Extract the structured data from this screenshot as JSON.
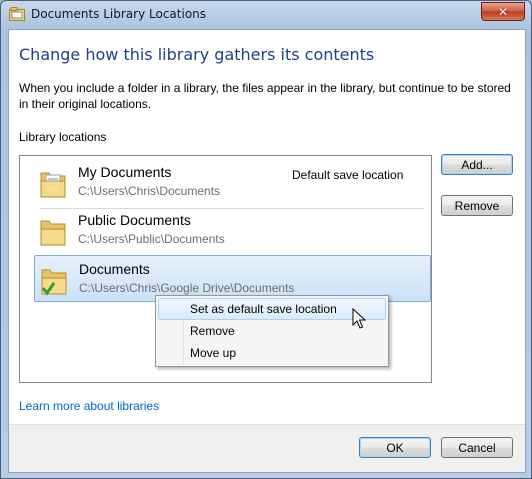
{
  "window": {
    "title": "Documents Library Locations",
    "close_label": "✕"
  },
  "heading": "Change how this library gathers its contents",
  "description": "When you include a folder in a library, the files appear in the library, but continue to be stored in their original locations.",
  "locations_label": "Library locations",
  "locations": [
    {
      "name": "My Documents",
      "path": "C:\\Users\\Chris\\Documents",
      "badge": "Default save location",
      "icon": "folder-with-document-icon"
    },
    {
      "name": "Public Documents",
      "path": "C:\\Users\\Public\\Documents",
      "badge": "",
      "icon": "folder-icon"
    },
    {
      "name": "Documents",
      "path": "C:\\Users\\Chris\\Google Drive\\Documents",
      "badge": "",
      "icon": "folder-synced-icon",
      "selected": true
    }
  ],
  "buttons": {
    "add": "Add...",
    "remove": "Remove",
    "ok": "OK",
    "cancel": "Cancel"
  },
  "link": "Learn more about libraries",
  "context_menu": [
    {
      "label": "Set as default save location",
      "highlighted": true
    },
    {
      "label": "Remove"
    },
    {
      "label": "Move up"
    }
  ],
  "colors": {
    "heading": "#1e3f8c",
    "link": "#0066cc",
    "selection": "#cbe1f7"
  }
}
